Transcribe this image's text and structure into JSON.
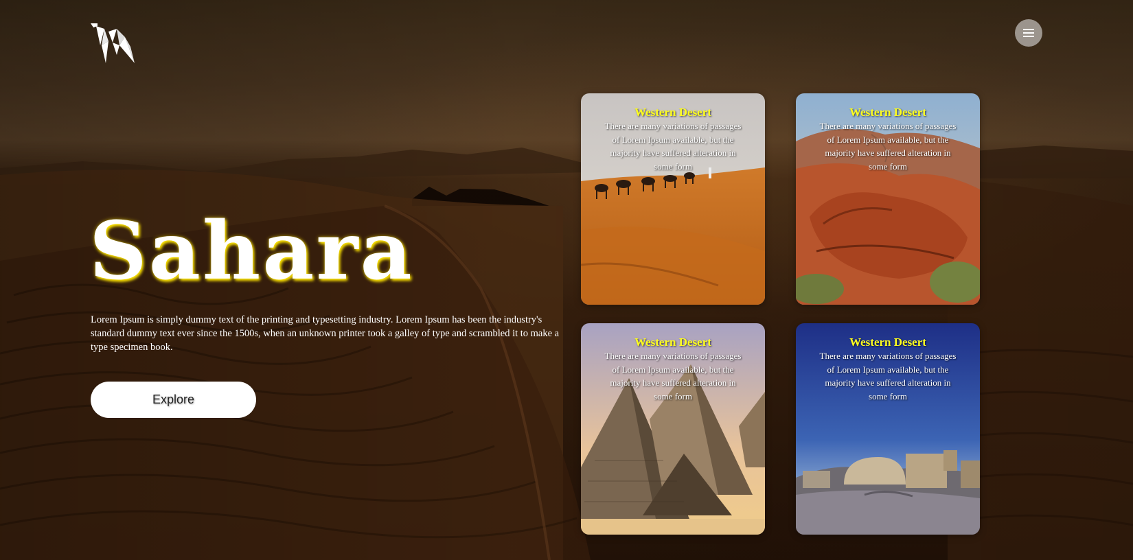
{
  "header": {
    "logo_icon": "origami-camel-logo-icon",
    "menu_icon": "hamburger-menu-icon"
  },
  "hero": {
    "title": "Sahara",
    "description": "Lorem Ipsum is simply dummy text of the printing and typesetting industry. Lorem Ipsum has been the industry's standard dummy text ever since the 1500s, when an unknown printer took a galley of type and scrambled it to make a type specimen book.",
    "explore_label": "Explore"
  },
  "cards": [
    {
      "title": "Western Desert",
      "text": "There are many variations of passages of Lorem Ipsum available, but the majority have suffered alteration in some form",
      "image": "camel-caravan-dunes"
    },
    {
      "title": "Western Desert",
      "text": "There are many variations of passages of Lorem Ipsum available, but the majority have suffered alteration in some form",
      "image": "red-rock-canyon"
    },
    {
      "title": "Western Desert",
      "text": "There are many variations of passages of Lorem Ipsum available, but the majority have suffered alteration in some form",
      "image": "giza-pyramids"
    },
    {
      "title": "Western Desert",
      "text": "There are many variations of passages of Lorem Ipsum available, but the majority have suffered alteration in some form",
      "image": "ancient-ruins-night"
    }
  ],
  "colors": {
    "card_title": "#ffff1f",
    "title_glow": "#ffe600",
    "button_bg": "#ffffff",
    "background": "#3a220f"
  }
}
